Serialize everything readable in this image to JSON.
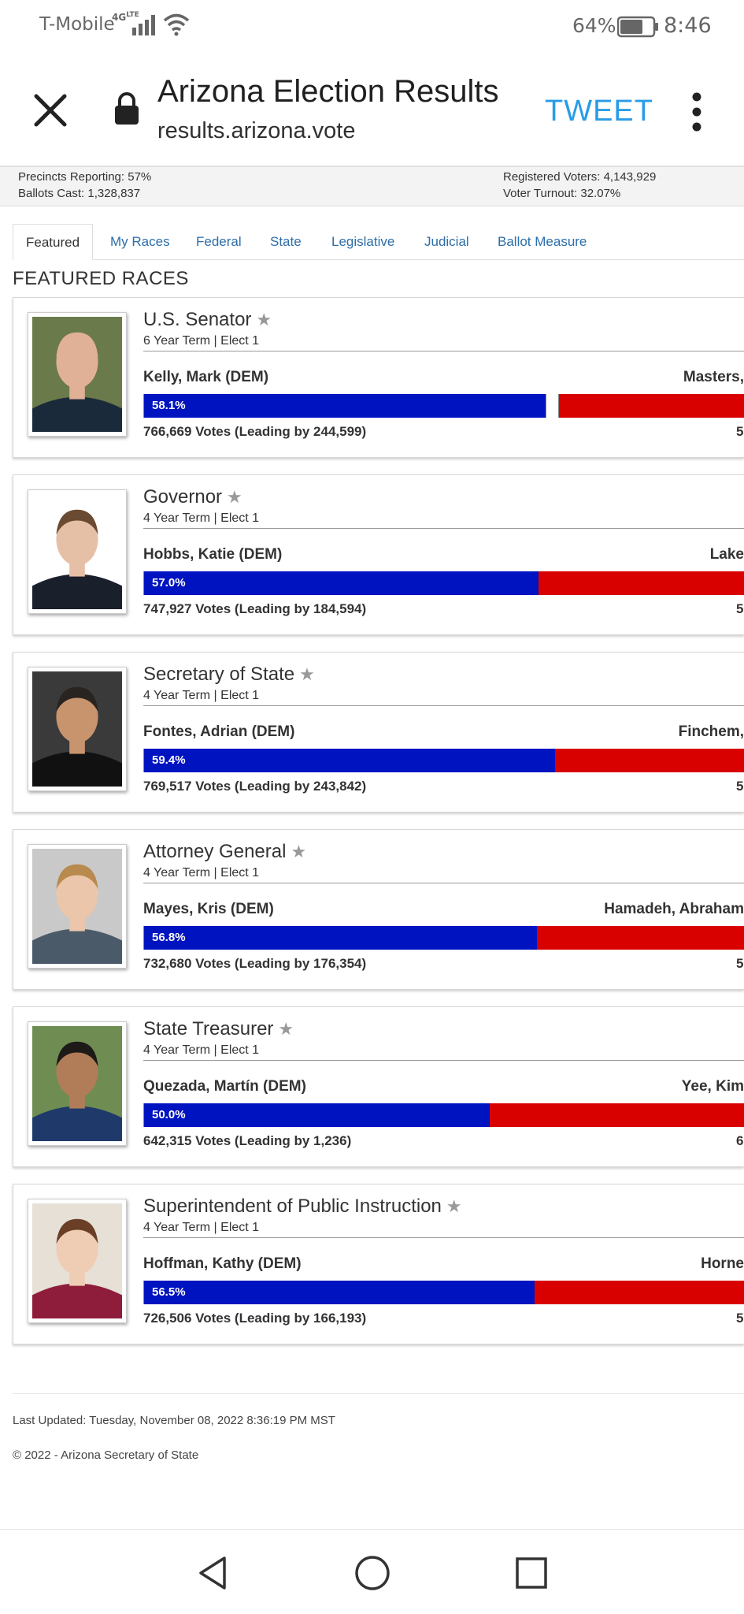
{
  "status_bar": {
    "carrier": "T-Mobile",
    "network": "4G LTE",
    "battery_pct": "64%",
    "time": "8:46",
    "icons": [
      "signal-icon",
      "wifi-icon",
      "battery-icon"
    ]
  },
  "browser": {
    "title": "Arizona Election Results",
    "url": "results.arizona.vote",
    "tweet_label": "TWEET",
    "icons": [
      "close-icon",
      "lock-icon",
      "more-vert-icon"
    ]
  },
  "summary": {
    "precincts": "Precincts Reporting: 57%",
    "ballots": "Ballots Cast: 1,328,837",
    "registered": "Registered Voters: 4,143,929",
    "turnout": "Voter Turnout: 32.07%"
  },
  "tabs": [
    {
      "label": "Featured",
      "active": true
    },
    {
      "label": "My Races",
      "active": false
    },
    {
      "label": "Federal",
      "active": false
    },
    {
      "label": "State",
      "active": false
    },
    {
      "label": "Legislative",
      "active": false
    },
    {
      "label": "Judicial",
      "active": false
    },
    {
      "label": "Ballot Measure",
      "active": false
    }
  ],
  "section_title": "FEATURED RACES",
  "races": [
    {
      "office": "U.S. Senator",
      "term": "6 Year Term  |  Elect 1",
      "leader": "Kelly, Mark (DEM)",
      "opponent": "Masters, ",
      "leader_pct": "58.1%",
      "leader_share": 0.667,
      "third_share": 0.022,
      "votes": "766,669 Votes   (Leading by 244,599)",
      "right_num": "5",
      "colors": {
        "skin": "#e0b097",
        "shirt": "#1b2a3a",
        "bg": "#6a7a4a",
        "hair": "#e0b097"
      }
    },
    {
      "office": "Governor",
      "term": "4 Year Term  |  Elect 1",
      "leader": "Hobbs, Katie (DEM)",
      "opponent": "Lake",
      "leader_pct": "57.0%",
      "leader_share": 0.656,
      "third_share": 0,
      "votes": "747,927 Votes   (Leading by 184,594)",
      "right_num": "5",
      "colors": {
        "skin": "#e6c0a6",
        "shirt": "#1a1f2c",
        "bg": "#ffffff",
        "hair": "#6b4a32"
      }
    },
    {
      "office": "Secretary of State",
      "term": "4 Year Term  |  Elect 1",
      "leader": "Fontes, Adrian (DEM)",
      "opponent": "Finchem,",
      "leader_pct": "59.4%",
      "leader_share": 0.683,
      "third_share": 0,
      "votes": "769,517 Votes   (Leading by 243,842)",
      "right_num": "5",
      "colors": {
        "skin": "#c8946e",
        "shirt": "#111111",
        "bg": "#3a3a3a",
        "hair": "#2a2420"
      }
    },
    {
      "office": "Attorney General",
      "term": "4 Year Term  |  Elect 1",
      "leader": "Mayes, Kris (DEM)",
      "opponent": "Hamadeh, Abraham",
      "leader_pct": "56.8%",
      "leader_share": 0.653,
      "third_share": 0,
      "votes": "732,680 Votes   (Leading by 176,354)",
      "right_num": "5",
      "colors": {
        "skin": "#ecc6aa",
        "shirt": "#4b5a68",
        "bg": "#c9c9c9",
        "hair": "#b88a4e"
      }
    },
    {
      "office": "State Treasurer",
      "term": "4 Year Term  |  Elect 1",
      "leader": "Quezada, Martín (DEM)",
      "opponent": "Yee, Kim",
      "leader_pct": "50.0%",
      "leader_share": 0.575,
      "third_share": 0,
      "votes": "642,315 Votes   (Leading by 1,236)",
      "right_num": "6",
      "colors": {
        "skin": "#b07d58",
        "shirt": "#1f3a6a",
        "bg": "#6f8d52",
        "hair": "#1d1a18"
      }
    },
    {
      "office": "Superintendent of Public Instruction",
      "term": "4 Year Term  |  Elect 1",
      "leader": "Hoffman, Kathy (DEM)",
      "opponent": "Horne",
      "leader_pct": "56.5%",
      "leader_share": 0.649,
      "third_share": 0,
      "votes": "726,506 Votes   (Leading by 166,193)",
      "right_num": "5",
      "colors": {
        "skin": "#efcdb4",
        "shirt": "#8e1d3c",
        "bg": "#e6e0d6",
        "hair": "#6a3f26"
      }
    }
  ],
  "footer": {
    "last_updated": "Last Updated:  Tuesday, November 08, 2022 8:36:19 PM MST",
    "copyright": "© 2022 - Arizona Secretary of State"
  },
  "nav": {
    "icons": [
      "back-icon",
      "home-icon",
      "recents-icon"
    ]
  }
}
